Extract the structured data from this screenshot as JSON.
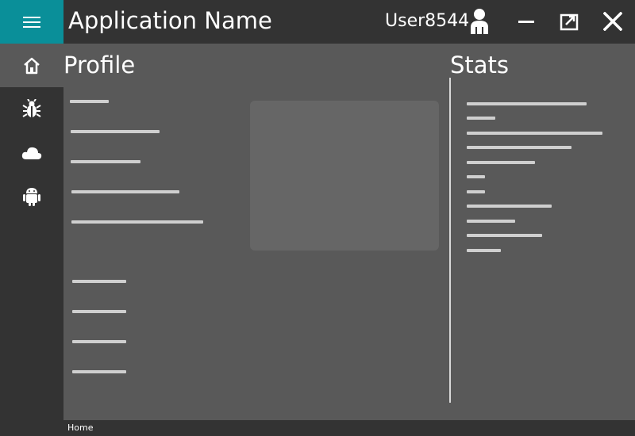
{
  "app": {
    "title": "Application Name",
    "accent_color": "#0a8f99"
  },
  "header": {
    "username": "User8544",
    "user_icon": "person-icon",
    "window_controls": [
      "minimize-icon",
      "restore-icon",
      "close-icon"
    ]
  },
  "sidebar": {
    "items": [
      {
        "icon": "home-icon",
        "active": true
      },
      {
        "icon": "bug-icon",
        "active": false
      },
      {
        "icon": "cloud-icon",
        "active": false
      },
      {
        "icon": "android-icon",
        "active": false
      }
    ]
  },
  "main": {
    "profile_title": "Profile",
    "stats_title": "Stats"
  },
  "status": {
    "text": "Home"
  }
}
